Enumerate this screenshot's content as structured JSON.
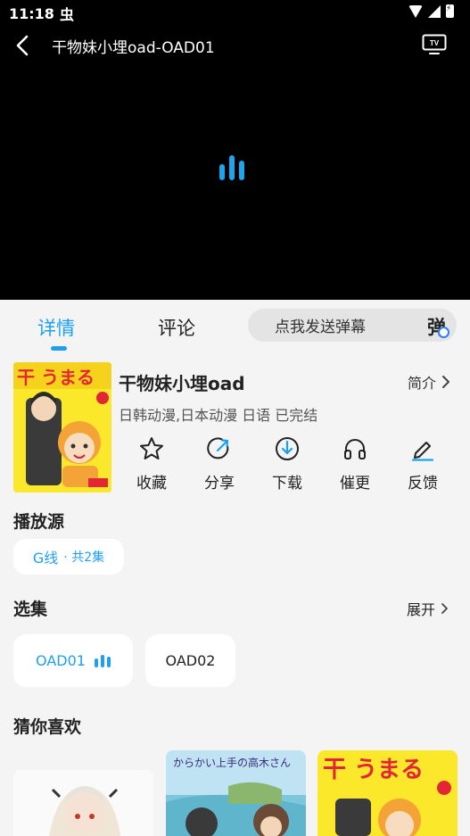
{
  "status": {
    "time": "11:18",
    "app_icon": "虫"
  },
  "player": {
    "title": "干物妹小埋oad-OAD01",
    "back_icon": "back-arrow-icon",
    "tv_icon": "tv-cast-icon",
    "tv_label": "TV",
    "loading_color": "#1fa6ea"
  },
  "tabs": [
    {
      "label": "详情",
      "active": true
    },
    {
      "label": "评论",
      "active": false
    }
  ],
  "danmaku": {
    "placeholder": "点我发送弹幕",
    "icon_text": "弹"
  },
  "info": {
    "title": "干物妹小埋oad",
    "intro_label": "简介",
    "meta": "日韩动漫,日本动漫 日语 已完结"
  },
  "actions": [
    {
      "label": "收藏",
      "icon": "star-icon"
    },
    {
      "label": "分享",
      "icon": "share-icon"
    },
    {
      "label": "下载",
      "icon": "download-icon"
    },
    {
      "label": "催更",
      "icon": "headphones-icon"
    },
    {
      "label": "反馈",
      "icon": "feedback-pen-icon"
    }
  ],
  "source": {
    "section_title": "播放源",
    "line": "G线",
    "count": "· 共2集"
  },
  "episodes": {
    "section_title": "选集",
    "expand_label": "展开",
    "items": [
      {
        "label": "OAD01",
        "playing": true
      },
      {
        "label": "OAD02",
        "playing": false
      }
    ]
  },
  "recommend": {
    "section_title": "猜你喜欢",
    "cover_text": "からかい上手の高木さん"
  },
  "colors": {
    "accent": "#1ea0ea",
    "background": "#f4f4f4",
    "cover_yellow": "#fbe82a"
  }
}
